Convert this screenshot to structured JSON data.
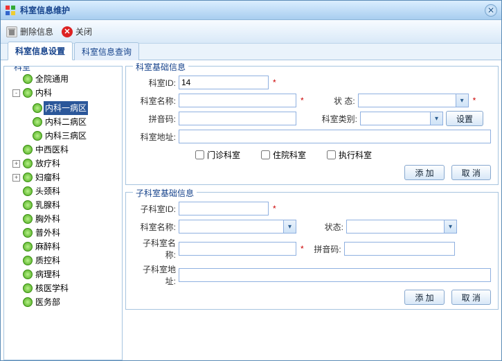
{
  "window": {
    "title": "科室信息维护"
  },
  "toolbar": {
    "delete": "删除信息",
    "close": "关闭"
  },
  "tabs": {
    "setup": "科室信息设置",
    "query": "科室信息查询"
  },
  "tree_legend": "科室",
  "tree": {
    "items": [
      {
        "label": "全院通用",
        "expander": ""
      },
      {
        "label": "内科",
        "expander": "-",
        "children": [
          {
            "label": "内科一病区",
            "selected": true
          },
          {
            "label": "内科二病区"
          },
          {
            "label": "内科三病区"
          }
        ]
      },
      {
        "label": "中西医科",
        "expander": ""
      },
      {
        "label": "放疗科",
        "expander": "+"
      },
      {
        "label": "妇瘤科",
        "expander": "+"
      },
      {
        "label": "头颈科",
        "expander": ""
      },
      {
        "label": "乳腺科",
        "expander": ""
      },
      {
        "label": "胸外科",
        "expander": ""
      },
      {
        "label": "普外科",
        "expander": ""
      },
      {
        "label": "麻醉科",
        "expander": ""
      },
      {
        "label": "质控科",
        "expander": ""
      },
      {
        "label": "病理科",
        "expander": ""
      },
      {
        "label": "核医学科",
        "expander": ""
      },
      {
        "label": "医务部",
        "expander": ""
      }
    ]
  },
  "form_top": {
    "legend": "科室基础信息",
    "dept_id_label": "科室ID:",
    "dept_id_value": "14",
    "dept_name_label": "科室名称:",
    "status_label": "状  态:",
    "pinyin_label": "拼音码:",
    "category_label": "科室类别:",
    "setbtn": "设置",
    "address_label": "科室地址:",
    "chk_outpatient": "门诊科室",
    "chk_inpatient": "住院科室",
    "chk_exec": "执行科室",
    "add": "添  加",
    "cancel": "取  消"
  },
  "form_bottom": {
    "legend": "子科室基础信息",
    "sub_id_label": "子科室ID:",
    "dept_name_label": "科室名称:",
    "status_label": "状态:",
    "sub_name_label": "子科室名称:",
    "pinyin_label": "拼音码:",
    "sub_addr_label": "子科室地址:",
    "add": "添  加",
    "cancel": "取  消"
  }
}
